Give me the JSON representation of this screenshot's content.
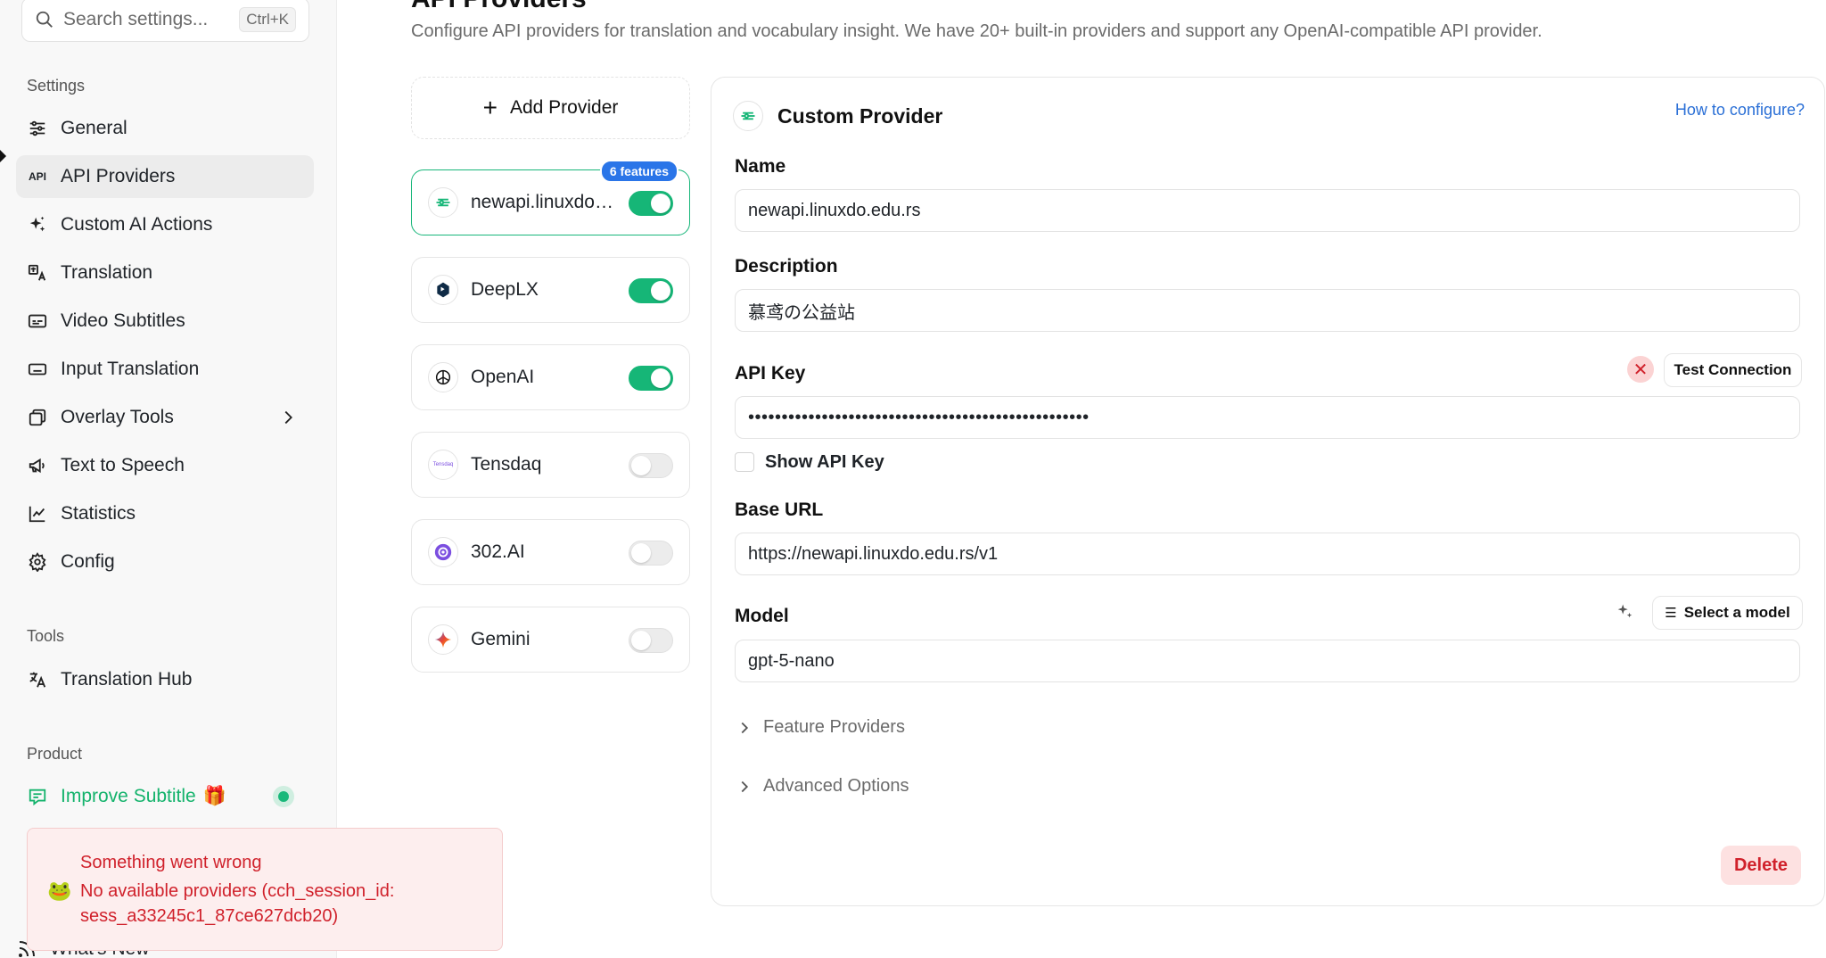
{
  "search": {
    "placeholder": "Search settings...",
    "shortcut": "Ctrl+K"
  },
  "sidebar": {
    "settings_title": "Settings",
    "items": [
      {
        "label": "General",
        "icon": "sliders-icon"
      },
      {
        "label": "API Providers",
        "icon": "api-icon",
        "icon_text": "API"
      },
      {
        "label": "Custom AI Actions",
        "icon": "sparkles-icon"
      },
      {
        "label": "Translation",
        "icon": "translate-icon"
      },
      {
        "label": "Video Subtitles",
        "icon": "subtitles-icon"
      },
      {
        "label": "Input Translation",
        "icon": "keyboard-icon"
      },
      {
        "label": "Overlay Tools",
        "icon": "layers-icon"
      },
      {
        "label": "Text to Speech",
        "icon": "megaphone-icon"
      },
      {
        "label": "Statistics",
        "icon": "chart-icon"
      },
      {
        "label": "Config",
        "icon": "gear-icon"
      }
    ],
    "tools_title": "Tools",
    "tools_items": [
      {
        "label": "Translation Hub",
        "icon": "translate-hub-icon"
      }
    ],
    "product_title": "Product",
    "product_items": [
      {
        "label": "Improve Subtitle",
        "emoji": "🎁"
      }
    ],
    "whats_new": "What's New"
  },
  "toast": {
    "icon": "🐸",
    "title": "Something went wrong",
    "message": "No available providers (cch_session_id: sess_a33245c1_87ce627dcb20)"
  },
  "main": {
    "title": "API Providers",
    "description": "Configure API providers for translation and vocabulary insight. We have 20+ built-in providers and support any OpenAI-compatible API provider.",
    "add_provider": "Add Provider",
    "providers": [
      {
        "name": "newapi.linuxdo.edu.rs",
        "enabled": true,
        "badge": "6 features",
        "selected": true
      },
      {
        "name": "DeepLX",
        "enabled": true
      },
      {
        "name": "OpenAI",
        "enabled": true
      },
      {
        "name": "Tensdaq",
        "enabled": false,
        "logo_text": "Tensdaq"
      },
      {
        "name": "302.AI",
        "enabled": false
      },
      {
        "name": "Gemini",
        "enabled": false
      }
    ]
  },
  "detail": {
    "title": "Custom Provider",
    "how_link": "How to configure?",
    "name_label": "Name",
    "name_value": "newapi.linuxdo.edu.rs",
    "desc_label": "Description",
    "desc_value": "慕鸢の公益站",
    "apikey_label": "API Key",
    "apikey_value": "•••••••••••••••••••••••••••••••••••••••••••••••••••",
    "test_connection": "Test Connection",
    "show_api_key": "Show API Key",
    "baseurl_label": "Base URL",
    "baseurl_value": "https://newapi.linuxdo.edu.rs/v1",
    "model_label": "Model",
    "select_model": "Select a model",
    "model_value": "gpt-5-nano",
    "feature_providers": "Feature Providers",
    "advanced_options": "Advanced Options",
    "delete": "Delete"
  },
  "colors": {
    "accent_green": "#16b677",
    "link_blue": "#2a6fd6",
    "error_red": "#d0212b",
    "badge_blue": "#2a75e8"
  }
}
